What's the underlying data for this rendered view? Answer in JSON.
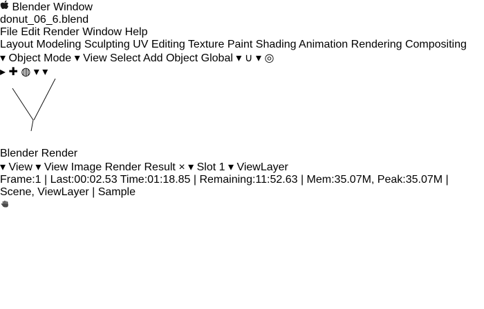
{
  "macos": {
    "app_name": "Blender",
    "window_menu": "Window"
  },
  "blender": {
    "title": "donut_06_6.blend",
    "menus": [
      "File",
      "Edit",
      "Render",
      "Window",
      "Help"
    ],
    "workspaces": [
      "Layout",
      "Modeling",
      "Sculpting",
      "UV Editing",
      "Texture Paint",
      "Shading",
      "Animation",
      "Rendering",
      "Compositing"
    ],
    "active_workspace": "Layout",
    "viewport": {
      "mode": "Object Mode",
      "menus": [
        "View",
        "Select",
        "Add",
        "Object"
      ],
      "orientation": "Global"
    }
  },
  "render": {
    "title": "Blender Render",
    "toolbar": {
      "view_dropdown": "View",
      "view_menu": "View",
      "image_menu": "Image",
      "image_name": "Render Result",
      "slot": "Slot 1",
      "layer": "ViewLayer"
    },
    "status": "Frame:1 | Last:00:02.53 Time:01:18.85 | Remaining:11:52.63 | Mem:35.07M, Peak:35.07M | Scene, ViewLayer | Sample"
  },
  "icons": {
    "chevron_down": "▾",
    "close": "×",
    "magnet": "∪",
    "proportional": "◎"
  },
  "colors": {
    "accent_blue": "#4772b3",
    "menubar_pink": "#f8b3c7",
    "desktop_purple": "#8e24aa",
    "blender_orange": "#e87d0d",
    "traffic_red": "#ff5f57",
    "traffic_yellow": "#febc2e",
    "traffic_green": "#28c840"
  }
}
